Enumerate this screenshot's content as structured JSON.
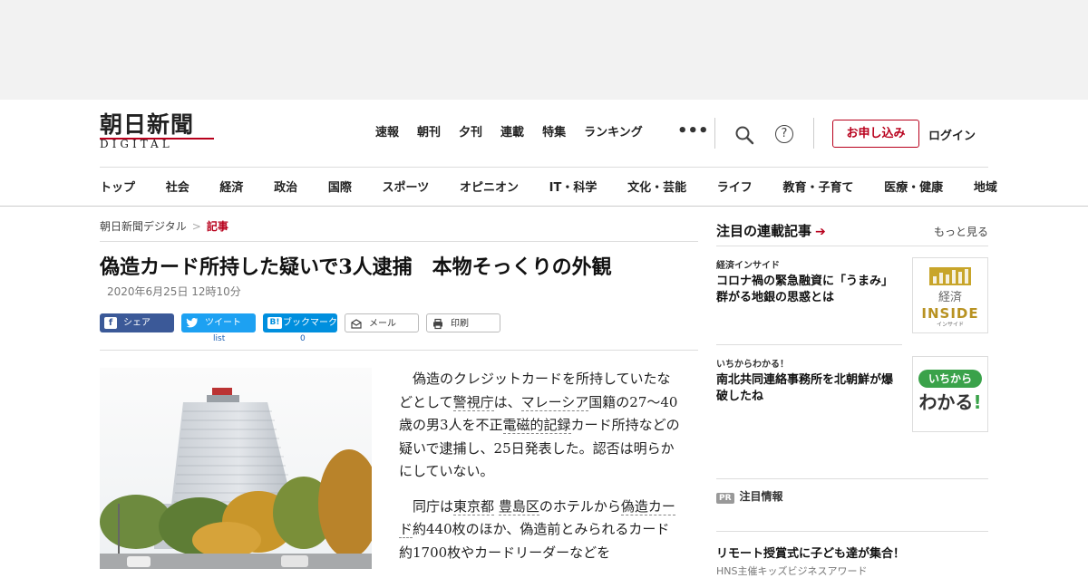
{
  "brand": {
    "logo_main": "朝日新聞",
    "logo_sub": "DIGITAL"
  },
  "top_nav": [
    "速報",
    "朝刊",
    "夕刊",
    "連載",
    "特集",
    "ランキング"
  ],
  "header": {
    "more": "•••",
    "help": "?",
    "subscribe": "お申し込み",
    "login": "ログイン"
  },
  "category_nav": [
    "トップ",
    "社会",
    "経済",
    "政治",
    "国際",
    "スポーツ",
    "オピニオン",
    "IT・科学",
    "文化・芸能",
    "ライフ",
    "教育・子育て",
    "医療・健康",
    "地域"
  ],
  "breadcrumb": {
    "home": "朝日新聞デジタル",
    "sep": ">",
    "current": "記事"
  },
  "article": {
    "headline": "偽造カード所持した疑いで3人逮捕　本物そっくりの外観",
    "date": "2020年6月25日 12時10分",
    "share": {
      "facebook": "シェア",
      "twitter": "ツイート",
      "hatena_icon": "B!",
      "hatena": "ブックマーク",
      "mail": "メール",
      "print": "印刷"
    },
    "counts": {
      "twitter": "list",
      "hatena": "0"
    },
    "p1": {
      "a": "偽造のクレジットカードを所持していたなどとして",
      "kw1": "警視庁",
      "b": "は、",
      "kw2": "マレーシア",
      "c": "国籍の27～40歳の男3人を不正",
      "kw3": "電磁的記録",
      "d": "カード所持などの疑いで逮捕し、25日発表した。認否は明らかにしていない。"
    },
    "p2": {
      "a": "同庁は",
      "kw1": "東京都",
      "kw2": "豊島区",
      "b": "のホテルから",
      "kw3": "偽造カード",
      "c": "約440枚のほか、偽造前とみられるカード約1700枚やカードリーダーなどを"
    }
  },
  "sidebar": {
    "title": "注目の連載記事",
    "arrow": "➔",
    "more": "もっと見る",
    "items": [
      {
        "kicker": "経済インサイド",
        "title": "コロナ禍の緊急融資に「うまみ」　群がる地銀の思惑とは",
        "thumb_top": "経済",
        "thumb_mid": "INSIDE",
        "thumb_sub": "インサイド"
      },
      {
        "kicker": "いちからわかる！",
        "title": "南北共同連絡事務所を北朝鮮が爆破したね",
        "thumb_top": "いちから",
        "thumb_mid": "わかる",
        "thumb_mark": "!"
      }
    ],
    "pr_badge": "PR",
    "pr_label": "注目情報",
    "promo_title": "リモート授賞式に子ども達が集合！",
    "promo_sub": "HNS主催キッズビジネスアワード"
  }
}
